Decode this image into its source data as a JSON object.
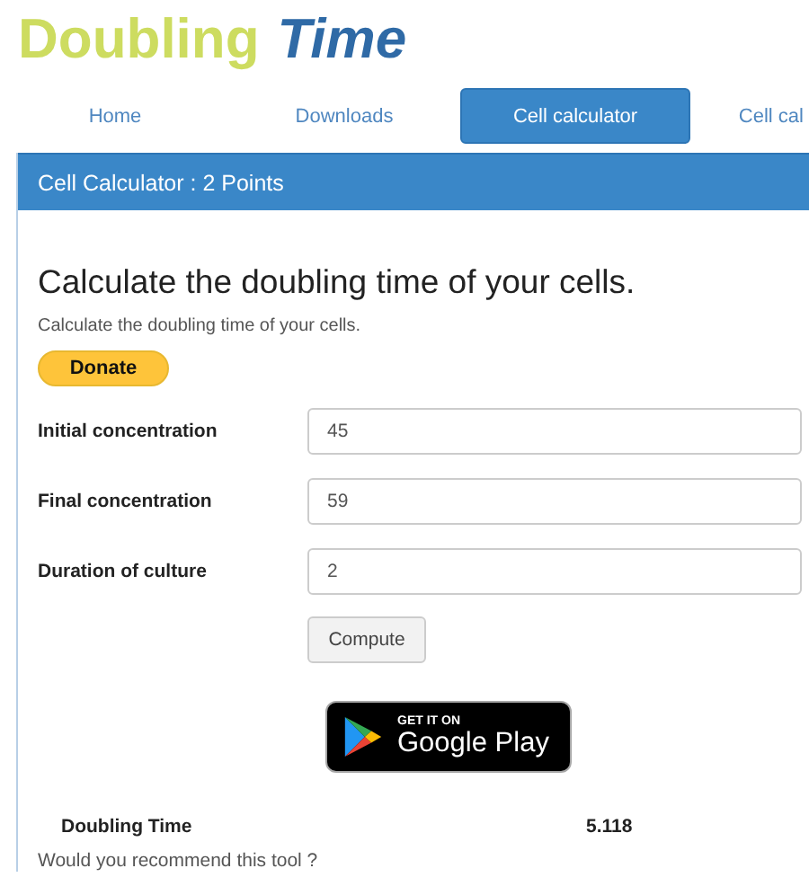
{
  "logo": {
    "first": "Doubling",
    "second": "Time"
  },
  "tabs": [
    {
      "label": "Home",
      "selected": false
    },
    {
      "label": "Downloads",
      "selected": false
    },
    {
      "label": "Cell calculator",
      "selected": true
    },
    {
      "label": "Cell cal",
      "selected": false
    }
  ],
  "panel": {
    "title": "Cell Calculator : 2 Points"
  },
  "heading": "Calculate the doubling time of your cells.",
  "subtitle": "Calculate the doubling time of your cells.",
  "donate_button": "Donate",
  "fields": [
    {
      "label": "Initial concentration",
      "value": "45"
    },
    {
      "label": "Final concentration",
      "value": "59"
    },
    {
      "label": "Duration of culture",
      "value": "2"
    }
  ],
  "compute_button": "Compute",
  "store_badge": {
    "small": "GET IT ON",
    "large": "Google Play"
  },
  "result": {
    "label": "Doubling Time",
    "value": "5.118"
  },
  "recommend": "Would you recommend this tool ?"
}
